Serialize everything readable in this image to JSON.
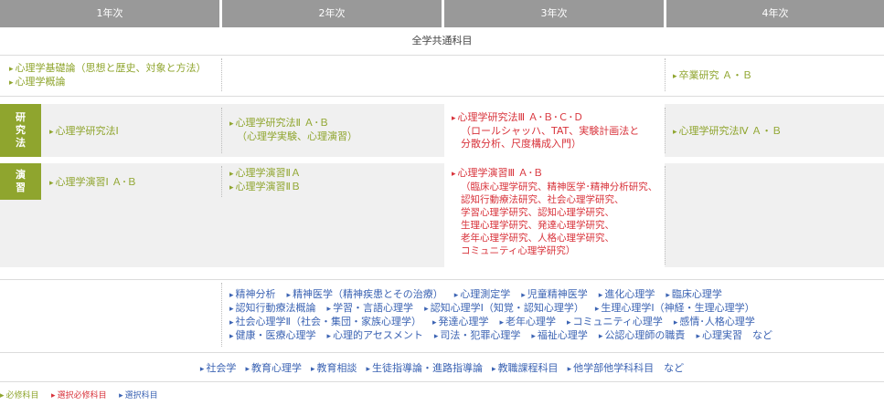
{
  "headers": [
    "1年次",
    "2年次",
    "3年次",
    "4年次"
  ],
  "common_label": "全学共通科目",
  "basic": {
    "y1": [
      "心理学基礎論（思想と歴史、対象と方法）",
      "心理学概論"
    ],
    "y4": "卒業研究 Ａ・Ｂ"
  },
  "research": {
    "tag": [
      "研",
      "究",
      "法"
    ],
    "y1": "心理学研究法Ⅰ",
    "y2": [
      "心理学研究法Ⅱ Ａ･Ｂ",
      "（心理学実験、心理演習）"
    ],
    "y3": [
      "心理学研究法Ⅲ Ａ･Ｂ･Ｃ･Ｄ",
      "（ロールシャッハ、TAT、実験計画法と",
      "分散分析、尺度構成入門）"
    ],
    "y4": "心理学研究法Ⅳ Ａ・Ｂ"
  },
  "seminar": {
    "tag": [
      "演",
      "習"
    ],
    "y1": "心理学演習Ⅰ Ａ･Ｂ",
    "y2": [
      "心理学演習ⅡＡ",
      "心理学演習ⅡＢ"
    ],
    "y3": [
      "心理学演習Ⅲ Ａ･Ｂ",
      "（臨床心理学研究、精神医学･精神分析研究、",
      "認知行動療法研究、社会心理学研究、",
      "学習心理学研究、認知心理学研究、",
      "生理心理学研究、発達心理学研究、",
      "老年心理学研究、人格心理学研究、",
      "コミュニティ心理学研究）"
    ]
  },
  "electives": [
    [
      "精神分析",
      "精神医学（精神疾患とその治療）",
      "心理測定学",
      "児童精神医学",
      "進化心理学",
      "臨床心理学"
    ],
    [
      "認知行動療法概論",
      "学習・言語心理学",
      "認知心理学Ⅰ（知覚・認知心理学）",
      "生理心理学Ⅰ（神経・生理心理学）"
    ],
    [
      "社会心理学Ⅱ（社会・集団・家族心理学）",
      "発達心理学",
      "老年心理学",
      "コミュニティ心理学",
      "感情･人格心理学"
    ],
    [
      "健康・医療心理学",
      "心理的アセスメント",
      "司法・犯罪心理学",
      "福祉心理学",
      "公認心理師の職責",
      "心理実習　など"
    ]
  ],
  "others": [
    "社会学",
    "教育心理学",
    "教育相談",
    "生徒指導論・進路指導論",
    "教職課程科目",
    "他学部他学科科目　など"
  ],
  "legend": [
    "必修科目",
    "選択必修科目",
    "選択科目"
  ],
  "colors": {
    "required": "#8fa52e",
    "selective_required": "#d8333b",
    "elective": "#3b63b3",
    "header": "#999999"
  }
}
